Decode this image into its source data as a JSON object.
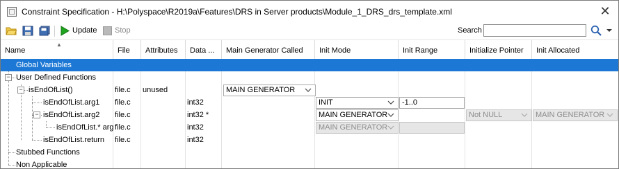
{
  "window": {
    "title": "Constraint Specification - H:\\Polyspace\\R2019a\\Features\\DRS in Server products\\Module_1_DRS_drs_template.xml",
    "close_glyph": "✕"
  },
  "toolbar": {
    "icons": [
      "open-folder-icon",
      "save-icon",
      "save-as-icon"
    ],
    "update_label": "Update",
    "stop_label": "Stop",
    "search_label": "Search",
    "search_value": ""
  },
  "columns": [
    "Name",
    "File",
    "Attributes",
    "Data ...",
    "Main Generator Called",
    "Init Mode",
    "Init Range",
    "Initialize Pointer",
    "Init Allocated"
  ],
  "rows": [
    {
      "name": "Global Variables",
      "file": "",
      "attributes": "",
      "data_type": "",
      "selected": true
    },
    {
      "name": "User Defined Functions",
      "file": "",
      "attributes": "",
      "data_type": "",
      "expander": "−"
    },
    {
      "name": "isEndOfList()",
      "file": "file.c",
      "attributes": "unused",
      "data_type": "",
      "expander": "−",
      "main_generator_called": "MAIN GENERATOR"
    },
    {
      "name": "isEndOfList.arg1",
      "file": "file.c",
      "attributes": "",
      "data_type": "int32",
      "init_mode": "INIT",
      "init_range": "-1..0"
    },
    {
      "name": "isEndOfList.arg2",
      "file": "file.c",
      "attributes": "",
      "data_type": "int32 *",
      "expander": "−",
      "init_mode": "MAIN GENERATOR",
      "initialize_pointer": "Not NULL",
      "init_allocated": "MAIN GENERATOR"
    },
    {
      "name": "isEndOfList.* arg",
      "file": "file.c",
      "attributes": "",
      "data_type": "int32",
      "init_mode": "MAIN GENERATOR"
    },
    {
      "name": "isEndOfList.return",
      "file": "file.c",
      "attributes": "",
      "data_type": "int32"
    },
    {
      "name": "Stubbed Functions",
      "file": "",
      "attributes": "",
      "data_type": ""
    },
    {
      "name": "Non Applicable",
      "file": "",
      "attributes": "",
      "data_type": ""
    }
  ],
  "colors": {
    "selection": "#1d78d5",
    "disabled_fill": "#e6e6e6",
    "play_green": "#1fa51f"
  }
}
